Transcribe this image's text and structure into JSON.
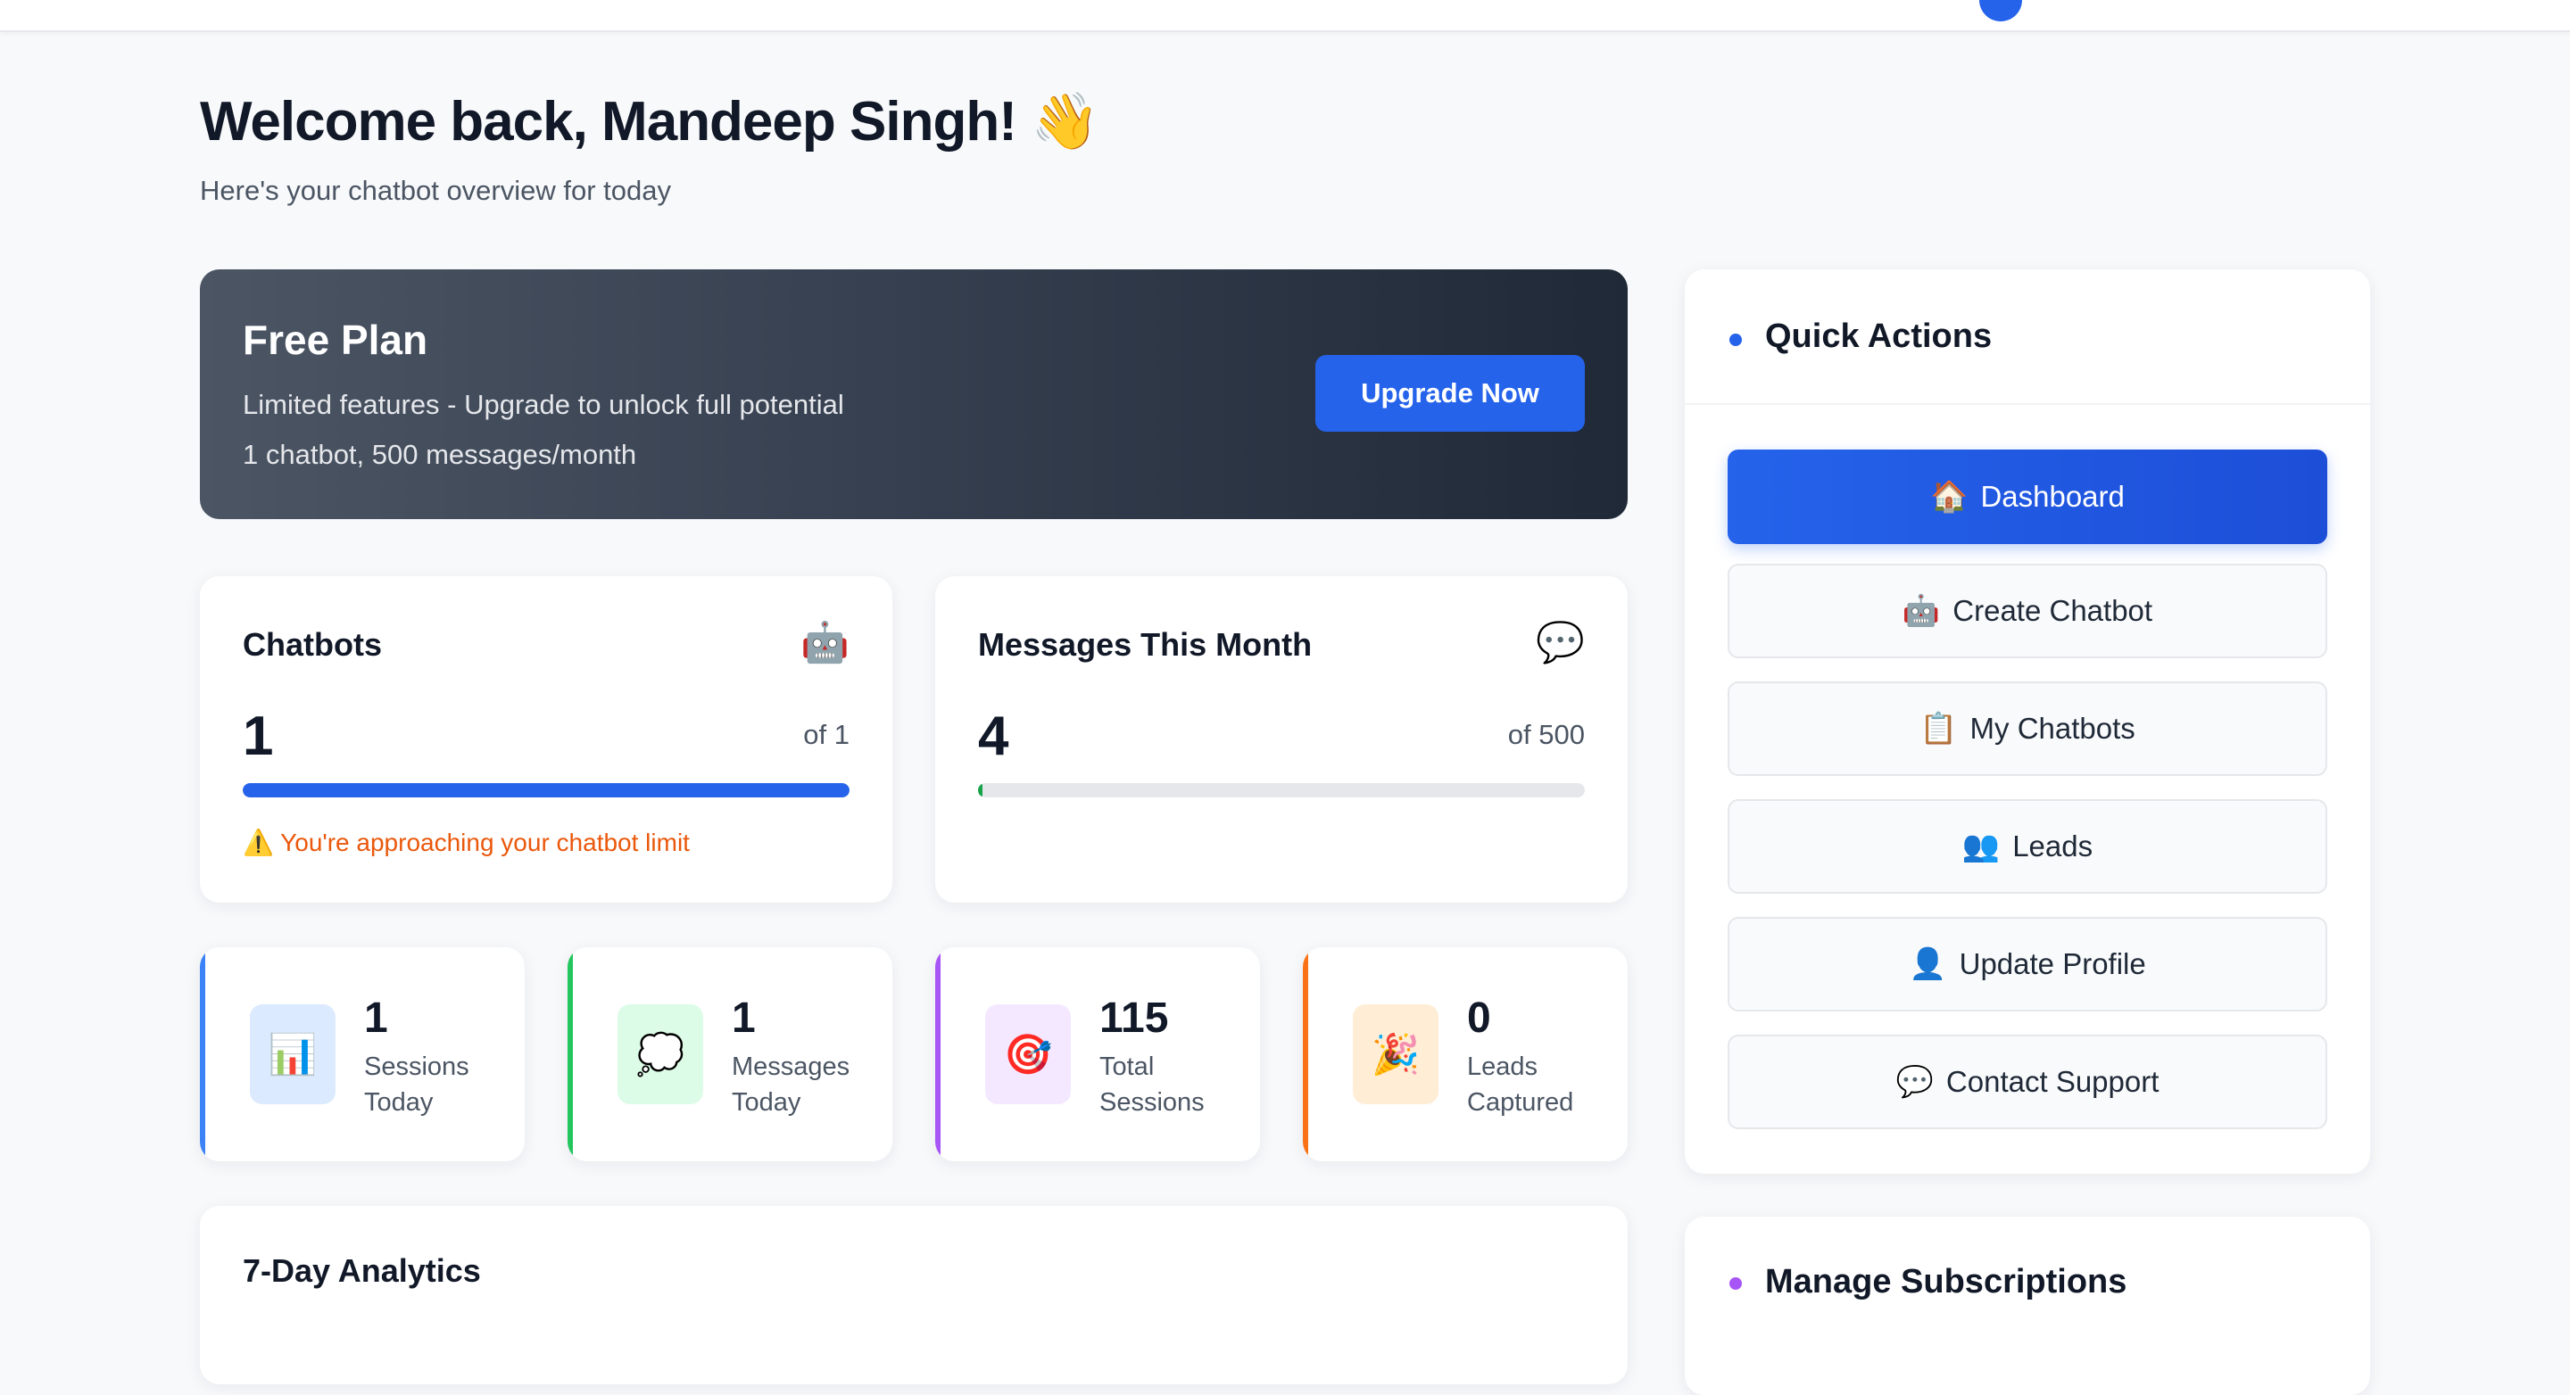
{
  "welcome": {
    "title": "Welcome back, Mandeep Singh! 👋",
    "subtitle": "Here's your chatbot overview for today"
  },
  "plan": {
    "name": "Free Plan",
    "description": "Limited features - Upgrade to unlock full potential",
    "limits": "1 chatbot, 500 messages/month",
    "upgrade_label": "Upgrade Now"
  },
  "usage": {
    "chatbots": {
      "title": "Chatbots",
      "icon": "🤖",
      "value": "1",
      "of": "of 1",
      "progress_fraction": 1.0,
      "bar_color": "#2563eb",
      "warning": "⚠️ You're approaching your chatbot limit"
    },
    "messages": {
      "title": "Messages This Month",
      "icon": "💬",
      "value": "4",
      "of": "of 500",
      "progress_fraction": 0.008,
      "bar_color": "#16a34a"
    }
  },
  "stats": [
    {
      "value": "1",
      "label_line1": "Sessions",
      "label_line2": "Today",
      "icon": "📊",
      "accent": "#3b82f6",
      "icon_bg": "#dbeafe"
    },
    {
      "value": "1",
      "label_line1": "Messages",
      "label_line2": "Today",
      "icon": "💭",
      "accent": "#22c55e",
      "icon_bg": "#dcfce7"
    },
    {
      "value": "115",
      "label_line1": "Total",
      "label_line2": "Sessions",
      "icon": "🎯",
      "accent": "#a855f7",
      "icon_bg": "#f3e8ff"
    },
    {
      "value": "0",
      "label_line1": "Leads",
      "label_line2": "Captured",
      "icon": "🎉",
      "accent": "#f97316",
      "icon_bg": "#ffedd5"
    }
  ],
  "analytics": {
    "title": "7-Day Analytics"
  },
  "quick_actions": {
    "title": "Quick Actions",
    "items": [
      {
        "icon": "🏠",
        "label": "Dashboard",
        "active": true
      },
      {
        "icon": "🤖",
        "label": "Create Chatbot",
        "active": false
      },
      {
        "icon": "📋",
        "label": "My Chatbots",
        "active": false
      },
      {
        "icon": "👥",
        "label": "Leads",
        "active": false
      },
      {
        "icon": "👤",
        "label": "Update Profile",
        "active": false
      },
      {
        "icon": "💬",
        "label": "Contact Support",
        "active": false
      }
    ]
  },
  "subscriptions": {
    "title": "Manage Subscriptions"
  },
  "colors": {
    "primary": "#2563eb",
    "warning": "#ea580c",
    "subs_dot": "#a855f7"
  }
}
